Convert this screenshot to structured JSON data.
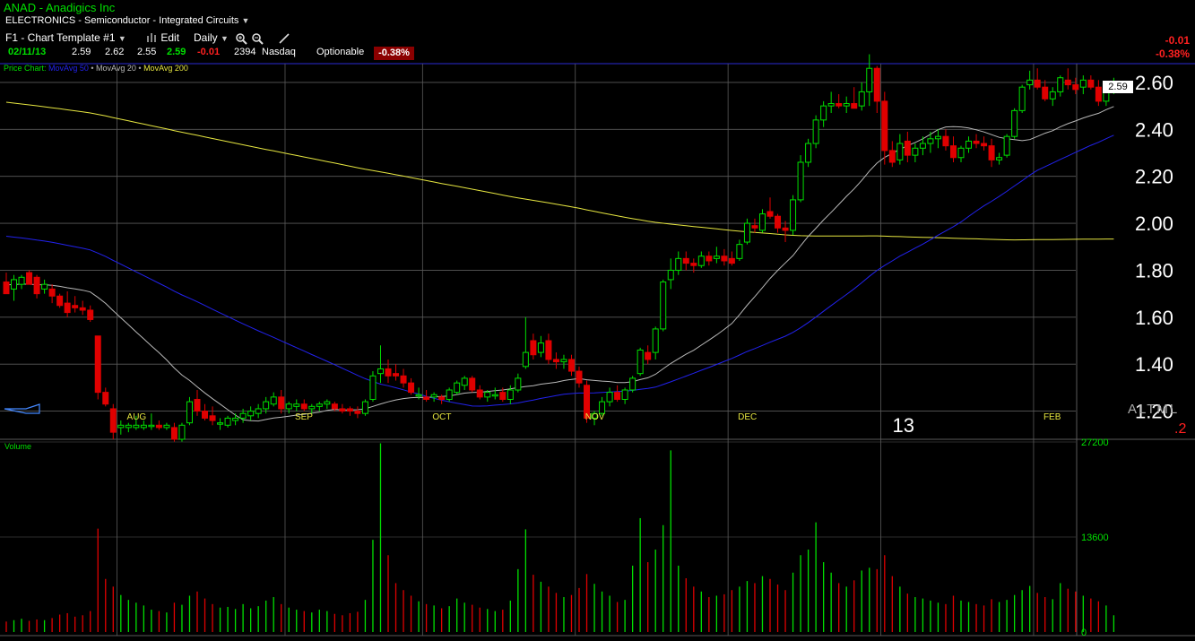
{
  "header": {
    "symbol_title": "ANAD - Anadigics Inc",
    "sector": "ELECTRONICS - Semiconductor - Integrated Circuits",
    "template": "F1 - Chart Template #1",
    "edit_label": "Edit",
    "interval": "Daily"
  },
  "quote": {
    "date": "02/11/13",
    "open": "2.59",
    "high": "2.62",
    "low": "2.55",
    "last": "2.59",
    "change": "-0.01",
    "volume": "2394",
    "exchange": "Nasdaq",
    "optionable": "Optionable",
    "change_pct": "-0.38%"
  },
  "top_right": {
    "change": "-0.01",
    "change_pct": "-0.38%"
  },
  "legend": {
    "price_chart": "Price Chart",
    "ma50": "MovAvg 50",
    "ma20": "MovAvg 20",
    "ma200": "MovAvg 200"
  },
  "corner": {
    "alt": "ALTML",
    "value": ".2"
  },
  "colors": {
    "up": "#00e000",
    "down": "#e00000",
    "ma50": "#2222ee",
    "ma20": "#b8b8b8",
    "ma200": "#e6e640",
    "grid": "#5a5a5a",
    "frame": "#2222aa"
  },
  "chart_data": {
    "type": "candlestick",
    "price_axis": {
      "ticks": [
        "2.60",
        "2.40",
        "2.20",
        "2.00",
        "1.80",
        "1.60",
        "1.40",
        "1.20"
      ],
      "range": [
        1.08,
        2.68
      ]
    },
    "volume_axis": {
      "title": "Volume",
      "ticks": [
        "27200",
        "13600",
        "0"
      ],
      "range": [
        0,
        27200
      ]
    },
    "month_labels": [
      "AUG",
      "SEP",
      "OCT",
      "NOV",
      "DEC",
      "13",
      "FEB"
    ],
    "last_price_tag": "2.59",
    "candles": [
      [
        1.75,
        1.79,
        1.7,
        1.7,
        1500
      ],
      [
        1.72,
        1.78,
        1.67,
        1.76,
        1700
      ],
      [
        1.74,
        1.78,
        1.72,
        1.77,
        1900
      ],
      [
        1.79,
        1.8,
        1.74,
        1.74,
        1600
      ],
      [
        1.77,
        1.78,
        1.68,
        1.7,
        1800
      ],
      [
        1.72,
        1.76,
        1.7,
        1.74,
        1700
      ],
      [
        1.72,
        1.74,
        1.66,
        1.69,
        2000
      ],
      [
        1.69,
        1.7,
        1.64,
        1.65,
        2500
      ],
      [
        1.66,
        1.71,
        1.6,
        1.62,
        2700
      ],
      [
        1.65,
        1.69,
        1.62,
        1.64,
        2200
      ],
      [
        1.64,
        1.67,
        1.61,
        1.63,
        2400
      ],
      [
        1.63,
        1.65,
        1.58,
        1.59,
        3000
      ],
      [
        1.52,
        1.52,
        1.25,
        1.28,
        14800
      ],
      [
        1.28,
        1.3,
        1.22,
        1.23,
        7600
      ],
      [
        1.21,
        1.23,
        1.08,
        1.11,
        6500
      ],
      [
        1.13,
        1.16,
        1.1,
        1.14,
        5300
      ],
      [
        1.13,
        1.15,
        1.11,
        1.14,
        4600
      ],
      [
        1.13,
        1.18,
        1.12,
        1.14,
        4200
      ],
      [
        1.13,
        1.16,
        1.12,
        1.14,
        3800
      ],
      [
        1.14,
        1.19,
        1.12,
        1.14,
        3200
      ],
      [
        1.14,
        1.16,
        1.12,
        1.13,
        3000
      ],
      [
        1.13,
        1.15,
        1.12,
        1.14,
        2800
      ],
      [
        1.13,
        1.15,
        1.07,
        1.08,
        4200
      ],
      [
        1.08,
        1.15,
        1.07,
        1.14,
        3900
      ],
      [
        1.15,
        1.26,
        1.14,
        1.24,
        5200
      ],
      [
        1.25,
        1.29,
        1.18,
        1.2,
        5800
      ],
      [
        1.2,
        1.23,
        1.16,
        1.17,
        4800
      ],
      [
        1.18,
        1.22,
        1.14,
        1.16,
        4000
      ],
      [
        1.15,
        1.17,
        1.12,
        1.15,
        3500
      ],
      [
        1.14,
        1.18,
        1.13,
        1.17,
        3600
      ],
      [
        1.16,
        1.19,
        1.14,
        1.17,
        3300
      ],
      [
        1.17,
        1.21,
        1.15,
        1.19,
        4000
      ],
      [
        1.18,
        1.22,
        1.16,
        1.2,
        3400
      ],
      [
        1.19,
        1.23,
        1.17,
        1.21,
        3700
      ],
      [
        1.21,
        1.26,
        1.19,
        1.24,
        4500
      ],
      [
        1.23,
        1.28,
        1.22,
        1.26,
        5000
      ],
      [
        1.26,
        1.29,
        1.19,
        1.21,
        4000
      ],
      [
        1.21,
        1.24,
        1.19,
        1.23,
        3500
      ],
      [
        1.22,
        1.25,
        1.2,
        1.23,
        3200
      ],
      [
        1.23,
        1.25,
        1.2,
        1.21,
        3000
      ],
      [
        1.21,
        1.23,
        1.19,
        1.22,
        2800
      ],
      [
        1.22,
        1.24,
        1.2,
        1.23,
        3200
      ],
      [
        1.23,
        1.25,
        1.21,
        1.24,
        3000
      ],
      [
        1.23,
        1.24,
        1.2,
        1.21,
        2600
      ],
      [
        1.21,
        1.23,
        1.19,
        1.2,
        2400
      ],
      [
        1.21,
        1.22,
        1.18,
        1.2,
        2700
      ],
      [
        1.2,
        1.22,
        1.17,
        1.19,
        2900
      ],
      [
        1.19,
        1.25,
        1.18,
        1.24,
        4600
      ],
      [
        1.25,
        1.37,
        1.24,
        1.35,
        13200
      ],
      [
        1.36,
        1.48,
        1.32,
        1.38,
        27000
      ],
      [
        1.38,
        1.42,
        1.32,
        1.35,
        11000
      ],
      [
        1.36,
        1.4,
        1.33,
        1.35,
        7000
      ],
      [
        1.35,
        1.38,
        1.3,
        1.32,
        6000
      ],
      [
        1.32,
        1.34,
        1.27,
        1.28,
        5200
      ],
      [
        1.27,
        1.3,
        1.25,
        1.27,
        4400
      ],
      [
        1.26,
        1.29,
        1.24,
        1.25,
        4000
      ],
      [
        1.26,
        1.28,
        1.24,
        1.27,
        3800
      ],
      [
        1.26,
        1.27,
        1.23,
        1.25,
        3400
      ],
      [
        1.25,
        1.3,
        1.24,
        1.29,
        3700
      ],
      [
        1.28,
        1.33,
        1.27,
        1.32,
        4800
      ],
      [
        1.31,
        1.35,
        1.29,
        1.34,
        4200
      ],
      [
        1.34,
        1.35,
        1.28,
        1.29,
        3900
      ],
      [
        1.29,
        1.31,
        1.25,
        1.26,
        3500
      ],
      [
        1.26,
        1.29,
        1.24,
        1.28,
        3300
      ],
      [
        1.27,
        1.3,
        1.25,
        1.27,
        3000
      ],
      [
        1.28,
        1.3,
        1.24,
        1.25,
        3200
      ],
      [
        1.25,
        1.31,
        1.23,
        1.29,
        4500
      ],
      [
        1.29,
        1.36,
        1.28,
        1.34,
        9000
      ],
      [
        1.39,
        1.6,
        1.38,
        1.45,
        14700
      ],
      [
        1.5,
        1.53,
        1.42,
        1.44,
        8200
      ],
      [
        1.45,
        1.52,
        1.43,
        1.49,
        7200
      ],
      [
        1.5,
        1.53,
        1.4,
        1.42,
        6500
      ],
      [
        1.42,
        1.45,
        1.38,
        1.41,
        5600
      ],
      [
        1.41,
        1.44,
        1.38,
        1.42,
        5000
      ],
      [
        1.42,
        1.44,
        1.35,
        1.37,
        5300
      ],
      [
        1.37,
        1.39,
        1.3,
        1.32,
        6300
      ],
      [
        1.31,
        1.33,
        1.15,
        1.17,
        8300
      ],
      [
        1.17,
        1.2,
        1.14,
        1.19,
        6900
      ],
      [
        1.19,
        1.26,
        1.18,
        1.24,
        5800
      ],
      [
        1.24,
        1.3,
        1.22,
        1.28,
        5200
      ],
      [
        1.28,
        1.31,
        1.24,
        1.25,
        4300
      ],
      [
        1.25,
        1.3,
        1.23,
        1.29,
        4600
      ],
      [
        1.29,
        1.35,
        1.28,
        1.34,
        9500
      ],
      [
        1.36,
        1.47,
        1.35,
        1.46,
        16300
      ],
      [
        1.45,
        1.48,
        1.4,
        1.42,
        10000
      ],
      [
        1.45,
        1.56,
        1.42,
        1.55,
        11800
      ],
      [
        1.55,
        1.76,
        1.54,
        1.75,
        15300
      ],
      [
        1.76,
        1.85,
        1.72,
        1.8,
        26000
      ],
      [
        1.8,
        1.88,
        1.78,
        1.85,
        9500
      ],
      [
        1.85,
        1.88,
        1.8,
        1.83,
        7700
      ],
      [
        1.83,
        1.85,
        1.79,
        1.82,
        6500
      ],
      [
        1.82,
        1.88,
        1.81,
        1.86,
        5800
      ],
      [
        1.86,
        1.88,
        1.82,
        1.84,
        5000
      ],
      [
        1.85,
        1.9,
        1.83,
        1.86,
        5200
      ],
      [
        1.86,
        1.89,
        1.82,
        1.84,
        5400
      ],
      [
        1.85,
        1.88,
        1.82,
        1.83,
        6000
      ],
      [
        1.85,
        1.93,
        1.84,
        1.91,
        6500
      ],
      [
        1.92,
        2.02,
        1.91,
        2.0,
        7300
      ],
      [
        1.99,
        2.02,
        1.96,
        1.98,
        7000
      ],
      [
        1.97,
        2.06,
        1.96,
        2.04,
        8000
      ],
      [
        2.05,
        2.11,
        2.02,
        2.03,
        7600
      ],
      [
        2.03,
        2.04,
        1.96,
        1.98,
        6800
      ],
      [
        1.98,
        2.01,
        1.92,
        1.97,
        6000
      ],
      [
        1.97,
        2.12,
        1.95,
        2.1,
        8500
      ],
      [
        2.1,
        2.29,
        2.09,
        2.26,
        11000
      ],
      [
        2.26,
        2.36,
        2.24,
        2.34,
        11800
      ],
      [
        2.34,
        2.46,
        2.32,
        2.44,
        15700
      ],
      [
        2.44,
        2.52,
        2.41,
        2.5,
        10000
      ],
      [
        2.5,
        2.56,
        2.47,
        2.51,
        8500
      ],
      [
        2.51,
        2.55,
        2.49,
        2.5,
        7000
      ],
      [
        2.5,
        2.54,
        2.47,
        2.51,
        6500
      ],
      [
        2.51,
        2.58,
        2.49,
        2.49,
        7400
      ],
      [
        2.5,
        2.6,
        2.48,
        2.56,
        8800
      ],
      [
        2.56,
        2.72,
        2.5,
        2.66,
        9200
      ],
      [
        2.66,
        2.67,
        2.47,
        2.52,
        9000
      ],
      [
        2.52,
        2.56,
        2.25,
        2.31,
        11000
      ],
      [
        2.31,
        2.35,
        2.24,
        2.26,
        8000
      ],
      [
        2.27,
        2.38,
        2.25,
        2.34,
        6500
      ],
      [
        2.35,
        2.39,
        2.26,
        2.29,
        5500
      ],
      [
        2.29,
        2.34,
        2.26,
        2.32,
        5000
      ],
      [
        2.32,
        2.37,
        2.29,
        2.34,
        4800
      ],
      [
        2.34,
        2.39,
        2.3,
        2.36,
        4500
      ],
      [
        2.36,
        2.4,
        2.32,
        2.37,
        4200
      ],
      [
        2.37,
        2.4,
        2.31,
        2.33,
        4000
      ],
      [
        2.33,
        2.37,
        2.26,
        2.28,
        5200
      ],
      [
        2.28,
        2.33,
        2.26,
        2.32,
        4500
      ],
      [
        2.32,
        2.37,
        2.3,
        2.35,
        4300
      ],
      [
        2.35,
        2.38,
        2.32,
        2.34,
        4000
      ],
      [
        2.34,
        2.37,
        2.31,
        2.33,
        3800
      ],
      [
        2.33,
        2.36,
        2.24,
        2.27,
        4700
      ],
      [
        2.27,
        2.3,
        2.25,
        2.28,
        4300
      ],
      [
        2.29,
        2.38,
        2.28,
        2.37,
        4600
      ],
      [
        2.37,
        2.49,
        2.36,
        2.48,
        5300
      ],
      [
        2.48,
        2.59,
        2.47,
        2.58,
        6000
      ],
      [
        2.59,
        2.65,
        2.57,
        2.61,
        6600
      ],
      [
        2.61,
        2.66,
        2.57,
        2.58,
        5600
      ],
      [
        2.58,
        2.61,
        2.52,
        2.53,
        5000
      ],
      [
        2.53,
        2.58,
        2.5,
        2.56,
        4700
      ],
      [
        2.56,
        2.63,
        2.54,
        2.62,
        7000
      ],
      [
        2.61,
        2.66,
        2.57,
        2.59,
        6200
      ],
      [
        2.59,
        2.62,
        2.55,
        2.57,
        5800
      ],
      [
        2.58,
        2.63,
        2.55,
        2.61,
        5200
      ],
      [
        2.61,
        2.63,
        2.57,
        2.58,
        4800
      ],
      [
        2.58,
        2.61,
        2.5,
        2.52,
        4400
      ],
      [
        2.52,
        2.6,
        2.5,
        2.59,
        3800
      ],
      [
        2.59,
        2.62,
        2.55,
        2.59,
        2400
      ]
    ]
  }
}
